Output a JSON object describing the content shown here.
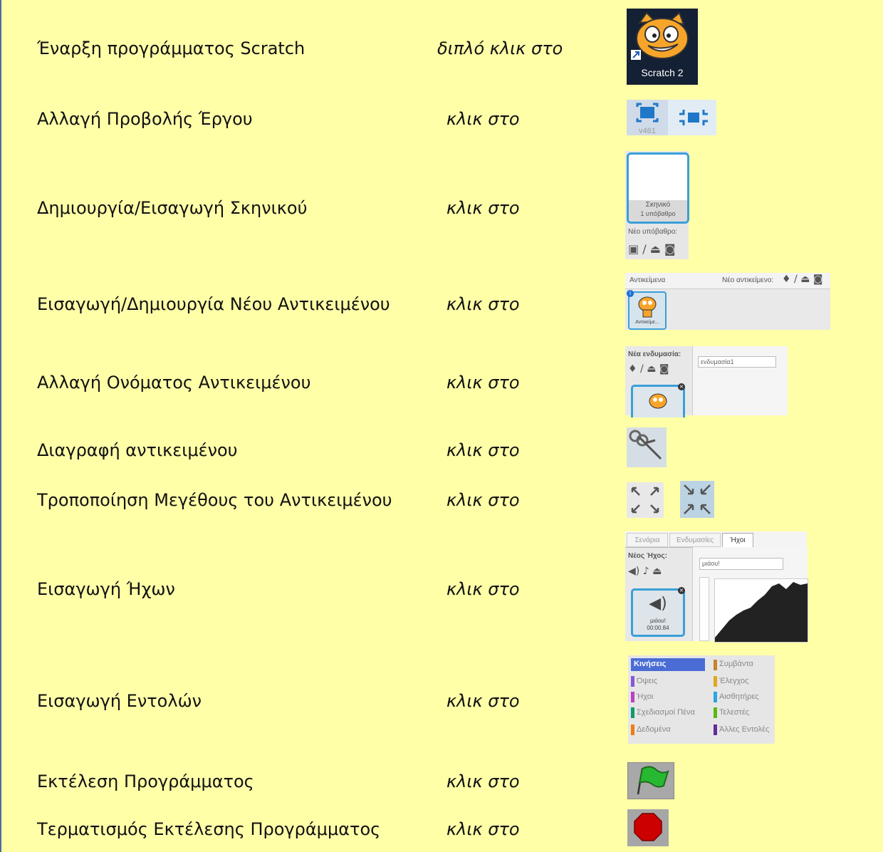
{
  "rows": [
    {
      "label": "Έναρξη προγράμματος Scratch",
      "action": "διπλό κλικ στο"
    },
    {
      "label": "Αλλαγή Προβολής Έργου",
      "action": "κλικ στο"
    },
    {
      "label": "Δημιουργία/Εισαγωγή Σκηνικού",
      "action": "κλικ στο"
    },
    {
      "label": "Εισαγωγή/Δημιουργία Νέου Αντικειμένου",
      "action": "κλικ στο"
    },
    {
      "label": "Αλλαγή Ονόματος Αντικειμένου",
      "action": "κλικ στο"
    },
    {
      "label": "Διαγραφή αντικειμένου",
      "action": "κλικ στο"
    },
    {
      "label": "Τροποποίηση Μεγέθους του Αντικειμένου",
      "action": "κλικ στο"
    },
    {
      "label": "Εισαγωγή Ήχων",
      "action": "κλικ στο"
    },
    {
      "label": "Εισαγωγή Εντολών",
      "action": "κλικ στο"
    },
    {
      "label": "Εκτέλεση Προγράμματος",
      "action": "κλικ στο"
    },
    {
      "label": "Τερματισμός Εκτέλεσης Προγράμματος",
      "action": "κλικ στο"
    }
  ],
  "icons": {
    "scratch_caption": "Scratch 2",
    "view_caption": "v461",
    "stage_name": "Σκηνικό",
    "stage_count": "1 υπόβαθρο",
    "new_backdrop": "Νέο υπόβαθρο:",
    "sprites_title": "Αντικείμενα",
    "new_sprite": "Νέο αντικείμενο:",
    "sprite_name": "Αντικείμε...",
    "new_costume": "Νέα ενδυμασία:",
    "costume_field": "ενδυμασία1",
    "tab_scripts": "Σενάρια",
    "tab_costumes": "Ενδυμασίες",
    "tab_sounds": "Ήχοι",
    "new_sound": "Νέος Ήχος:",
    "sound_field": "μιάου!",
    "sound_name": "μιάου!",
    "sound_time": "00:00.84"
  },
  "categories": [
    {
      "name": "Κινήσεις",
      "color": "#4a6cd4"
    },
    {
      "name": "Συμβάντα",
      "color": "#c88330"
    },
    {
      "name": "Όψεις",
      "color": "#8a55d7"
    },
    {
      "name": "Έλεγχος",
      "color": "#e1a91a"
    },
    {
      "name": "Ήχοι",
      "color": "#bb42c3"
    },
    {
      "name": "Αισθητήρες",
      "color": "#2ca5e2"
    },
    {
      "name": "Σχεδιασμοί Πένα",
      "color": "#0e9a6c"
    },
    {
      "name": "Τελεστές",
      "color": "#5cb712"
    },
    {
      "name": "Δεδομένα",
      "color": "#ee7d16"
    },
    {
      "name": "Άλλες Εντολές",
      "color": "#632d99"
    }
  ],
  "colors": {
    "background": "#ffffa8",
    "accent": "#3a9fd8",
    "border": "#4a6ea9"
  }
}
